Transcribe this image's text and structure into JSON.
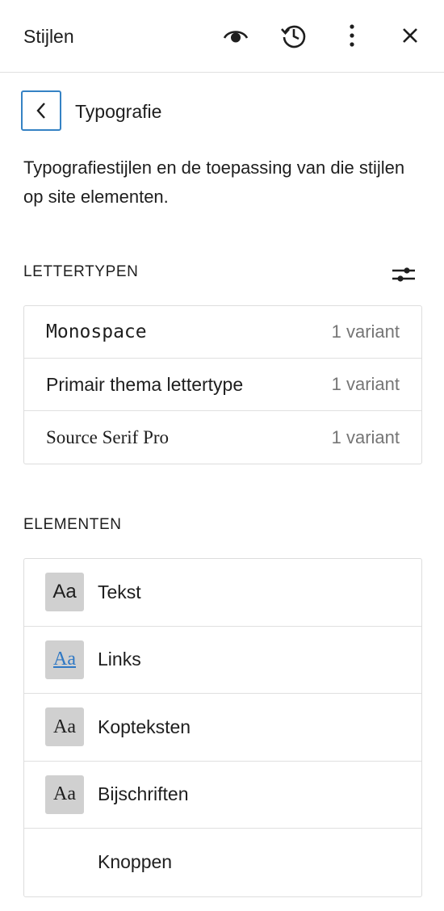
{
  "header": {
    "title": "Stijlen",
    "preview_icon": "eye-icon",
    "revisions_icon": "history-icon",
    "more_icon": "more-vertical-icon",
    "close_icon": "close-icon"
  },
  "nav": {
    "back_icon": "chevron-left-icon",
    "title": "Typografie"
  },
  "description": "Typografiestijlen en de toepassing van die stijlen op site elementen.",
  "fonts": {
    "label": "LETTERTYPEN",
    "settings_icon": "sliders-icon",
    "items": [
      {
        "name": "Monospace",
        "count": "1 variant"
      },
      {
        "name": "Primair thema lettertype",
        "count": "1 variant"
      },
      {
        "name": "Source Serif Pro",
        "count": "1 variant"
      }
    ]
  },
  "elements": {
    "label": "ELEMENTEN",
    "items": [
      {
        "preview": "Aa",
        "label": "Tekst"
      },
      {
        "preview": "Aa",
        "label": "Links"
      },
      {
        "preview": "Aa",
        "label": "Kopteksten"
      },
      {
        "preview": "Aa",
        "label": "Bijschriften"
      },
      {
        "preview": "",
        "label": "Knoppen"
      }
    ]
  },
  "colors": {
    "accent": "#3582c4",
    "link_preview": "#2f78c4",
    "muted_text": "#757575",
    "preview_bg": "#d0d0d0"
  }
}
